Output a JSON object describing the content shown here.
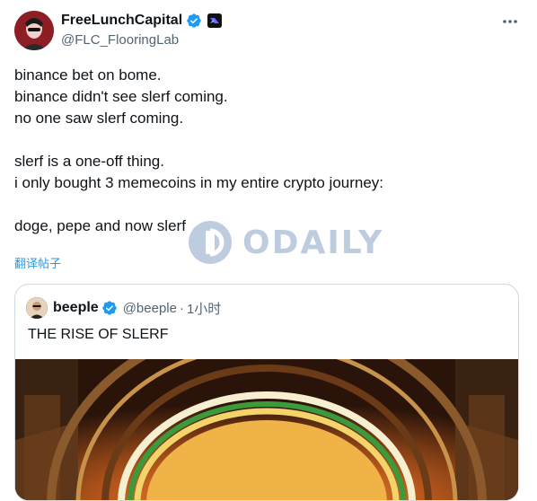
{
  "author": {
    "display_name": "FreeLunchCapital",
    "handle": "@FLC_FlooringLab",
    "verified_color": "#1d9bf0"
  },
  "tweet": {
    "lines": "binance bet on bome.\nbinance didn't see slerf coming.\nno one saw slerf coming.\n\nslerf is a one-off thing.\ni only bought 3 memecoins in my entire crypto journey:\n\ndoge, pepe and now slerf",
    "translate_label": "翻译帖子"
  },
  "watermark": {
    "text": "ODAILY"
  },
  "quoted_post": {
    "display_name": "beeple",
    "handle": "@beeple",
    "separator": "·",
    "time": "1小时",
    "text": "THE RISE OF SLERF"
  },
  "icons": {
    "verified": "verified-badge-icon",
    "affiliate": "affiliate-badge-icon",
    "more": "more-options-icon"
  }
}
